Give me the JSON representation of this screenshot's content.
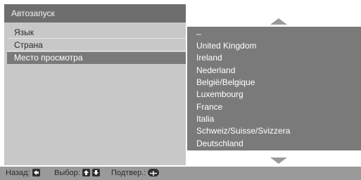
{
  "left_title": "Автозапуск",
  "menu": [
    {
      "label": "Язык"
    },
    {
      "label": "Страна"
    },
    {
      "label": "Место просмотра"
    }
  ],
  "list": [
    "–",
    "United Kingdom",
    "Ireland",
    "Nederland",
    "België/Belgique",
    "Luxembourg",
    "France",
    "Italia",
    "Schweiz/Suisse/Svizzera",
    "Deutschland"
  ],
  "footer": {
    "back_label": "Назад:",
    "select_label": "Выбор:",
    "confirm_label": "Подтвер.:"
  },
  "colors": {
    "title_bg": "#6e6e6e",
    "panel_bg": "#c8c8c8",
    "selected_bg": "#7a7a7a",
    "footer_bg": "#9a9a9a"
  }
}
